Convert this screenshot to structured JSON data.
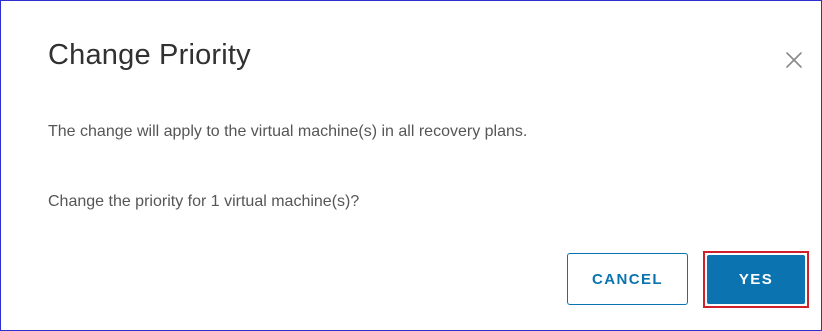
{
  "dialog": {
    "title": "Change Priority",
    "close_icon": "close-icon",
    "message_scope": "The change will apply to the virtual machine(s) in all recovery plans.",
    "message_confirm": "Change the priority for 1 virtual machine(s)?",
    "buttons": {
      "cancel_label": "CANCEL",
      "yes_label": "YES"
    }
  },
  "colors": {
    "primary": "#0b74b0",
    "highlight_border": "#d2202a",
    "dialog_border": "#2f2fd0",
    "title_text": "#313131",
    "body_text": "#565656"
  }
}
